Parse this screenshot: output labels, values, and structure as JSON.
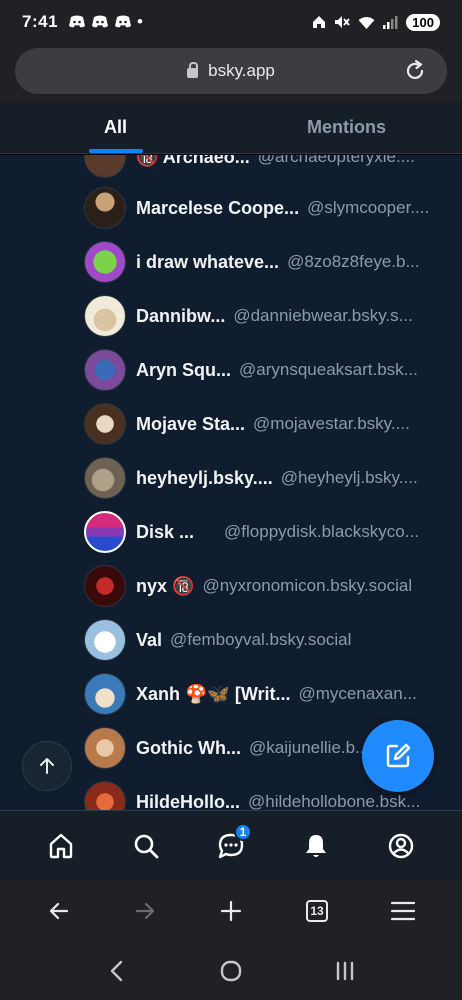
{
  "status_bar": {
    "time": "7:41",
    "dot": "•",
    "battery": "100",
    "left_icons": [
      "discord-icon",
      "discord-icon",
      "discord-icon"
    ],
    "right_icons": [
      "home-icon",
      "mute-icon",
      "wifi-icon",
      "signal-icon"
    ]
  },
  "browser": {
    "url": "bsky.app",
    "tab_count": "13"
  },
  "tabs": [
    {
      "label": "All",
      "active": true
    },
    {
      "label": "Mentions",
      "active": false
    }
  ],
  "feed": {
    "items": [
      {
        "name": "🔞 Archaeo...",
        "handle": "@archaeopteryxie....",
        "avatar": "#5a3a2a"
      },
      {
        "name": "Marcelese Coope...",
        "handle": "@slymcooper....",
        "avatar": "#3b2c22"
      },
      {
        "name": "i draw whateve...",
        "handle": "@8zo8z8feye.b...",
        "avatar": "#5fa344"
      },
      {
        "name": "Dannibw...",
        "handle": "@danniebwear.bsky.s...",
        "avatar": "#c9b08a"
      },
      {
        "name": "Aryn Squ...",
        "handle": "@arynsqueaksart.bsk...",
        "avatar": "#7b4a9a"
      },
      {
        "name": "Mojave Sta...",
        "handle": "@mojavestar.bsky....",
        "avatar": "#6a4e3a"
      },
      {
        "name": "heyheylj.bsky....",
        "handle": "@heyheylj.bsky....",
        "avatar": "#8a7a66"
      },
      {
        "name": "Disk ...",
        "handle": "@floppydisk.blackskyco...",
        "avatar": "#d62a7a"
      },
      {
        "name": "nyx 🔞",
        "handle": "@nyxronomicon.bsky.social",
        "avatar": "#6e1a1a"
      },
      {
        "name": "Val",
        "handle": "@femboyval.bsky.social",
        "avatar": "#c8d8ea"
      },
      {
        "name": "Xanh 🍄🦋 [Writ...",
        "handle": "@mycenaxan...",
        "avatar": "#4a8ab8"
      },
      {
        "name": "Gothic Wh...",
        "handle": "@kaijunellie.b...",
        "avatar": "#b87a4a"
      },
      {
        "name": "HildeHollo...",
        "handle": "@hildehollobone.bsk...",
        "avatar": "#c8442a"
      }
    ]
  },
  "fab": {
    "icon": "compose-icon"
  },
  "scroll_top": {
    "icon": "arrow-up-icon"
  },
  "app_nav": {
    "items": [
      {
        "name": "home",
        "icon": "home-icon"
      },
      {
        "name": "search",
        "icon": "search-icon"
      },
      {
        "name": "chat",
        "icon": "chat-icon",
        "badge": "1"
      },
      {
        "name": "notifications",
        "icon": "bell-icon"
      },
      {
        "name": "profile",
        "icon": "profile-icon"
      }
    ]
  },
  "colors": {
    "accent": "#1083fe",
    "background": "#101d2e",
    "header_bg": "#161e27",
    "browser_chrome": "#202124"
  }
}
